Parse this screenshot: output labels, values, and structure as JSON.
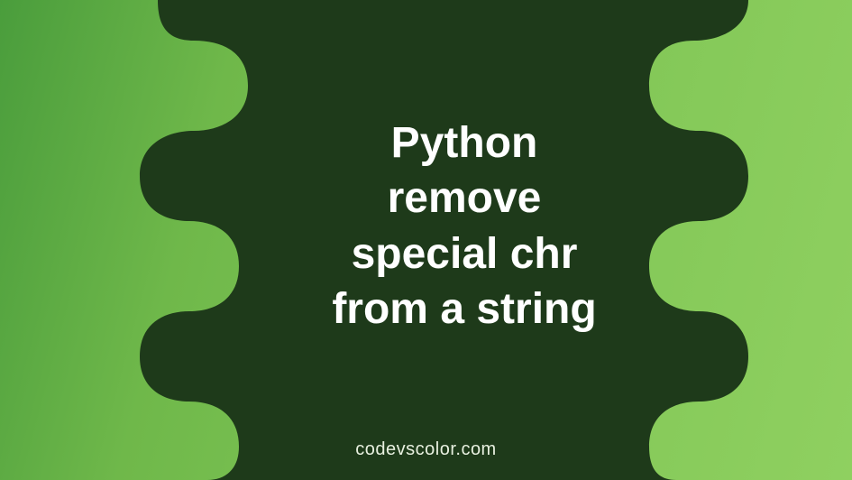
{
  "title_lines": {
    "l1": "Python",
    "l2": "remove",
    "l3": "special chr",
    "l4": "from a string"
  },
  "watermark": "codevscolor.com",
  "colors": {
    "blob": "#1e3a1a",
    "gradient_start": "#4a9d3c",
    "gradient_end": "#8fd060",
    "title": "#ffffff"
  }
}
